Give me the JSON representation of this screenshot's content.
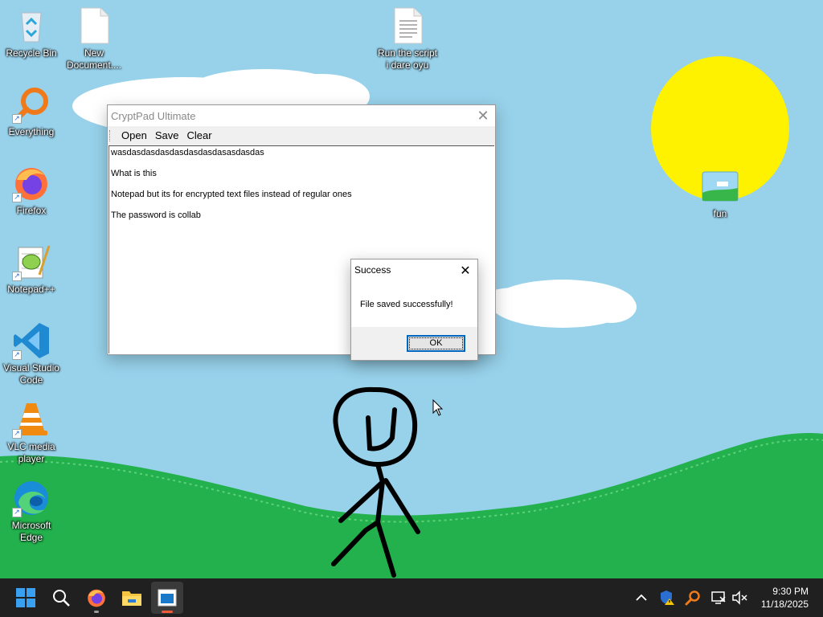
{
  "desktop": {
    "icons": [
      {
        "name": "recycle-bin",
        "label": "Recycle Bin"
      },
      {
        "name": "new-document",
        "label": "New\nDocument...."
      },
      {
        "name": "run-script",
        "label": "Run the script\ni dare oyu"
      },
      {
        "name": "everything",
        "label": "Everything"
      },
      {
        "name": "firefox",
        "label": "Firefox"
      },
      {
        "name": "notepadpp",
        "label": "Notepad++"
      },
      {
        "name": "vscode",
        "label": "Visual Studio\nCode"
      },
      {
        "name": "vlc",
        "label": "VLC media\nplayer"
      },
      {
        "name": "edge",
        "label": "Microsoft\nEdge"
      },
      {
        "name": "fun",
        "label": "fun"
      }
    ]
  },
  "app": {
    "title": "CryptPad Ultimate",
    "menu": [
      "Open",
      "Save",
      "Clear"
    ],
    "editor_lines": [
      "wasdasdasdasdasdasdasdasasdasdas",
      "",
      "What is this",
      "",
      "Notepad but its for encrypted text files instead of regular ones",
      "",
      "The password is collab"
    ]
  },
  "dialog": {
    "title": "Success",
    "message": "File saved successfully!",
    "ok_label": "OK"
  },
  "taskbar": {
    "time": "9:30 PM",
    "date": "11/18/2025",
    "icons": [
      "start-icon",
      "search-icon",
      "firefox-icon",
      "file-explorer-icon",
      "cryptpad-icon"
    ]
  },
  "colors": {
    "sky": "#97d1ea",
    "grass": "#22b14c",
    "sun": "#fff200",
    "taskbar": "#202020",
    "accent": "#0067c0"
  }
}
